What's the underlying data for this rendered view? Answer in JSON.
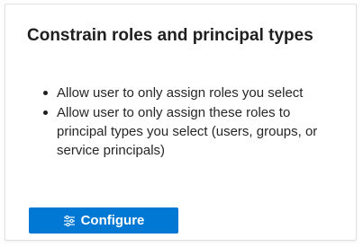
{
  "card": {
    "title": "Constrain roles and principal types",
    "bullets": [
      "Allow user to only assign roles you select",
      "Allow user to only assign these roles to principal types you select (users, groups, or service principals)"
    ],
    "configure_button": {
      "label": "Configure",
      "icon": "settings-sliders-icon"
    }
  },
  "colors": {
    "button_bg": "#0078d4",
    "button_text": "#ffffff",
    "card_border": "#e1e1e1"
  }
}
